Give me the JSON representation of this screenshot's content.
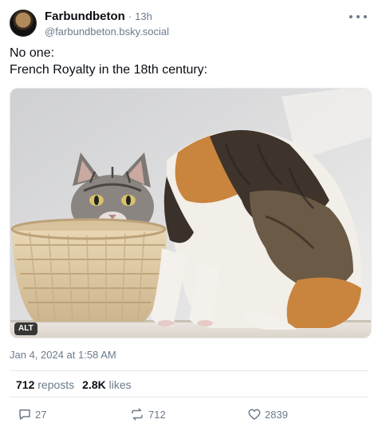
{
  "author": {
    "display_name": "Farbundbeton",
    "separator": "·",
    "time_ago": "13h",
    "handle": "@farbundbeton.bsky.social"
  },
  "post": {
    "lines": [
      "No one:",
      "French Royalty in the 18th century:"
    ],
    "alt_badge": "ALT",
    "timestamp": "Jan 4, 2024 at 1:58 AM"
  },
  "stats": {
    "reposts_count": "712",
    "reposts_label": "reposts",
    "likes_count": "2.8K",
    "likes_label": "likes"
  },
  "actions": {
    "reply_count": "27",
    "repost_count": "712",
    "like_count": "2839"
  },
  "icons": {
    "reply": "reply-icon",
    "repost": "repost-icon",
    "like": "heart-icon",
    "more": "more-horizontal-icon"
  },
  "colors": {
    "text": "#0b0f14",
    "muted": "#6b7b8c",
    "divider": "#e6e8eb"
  }
}
